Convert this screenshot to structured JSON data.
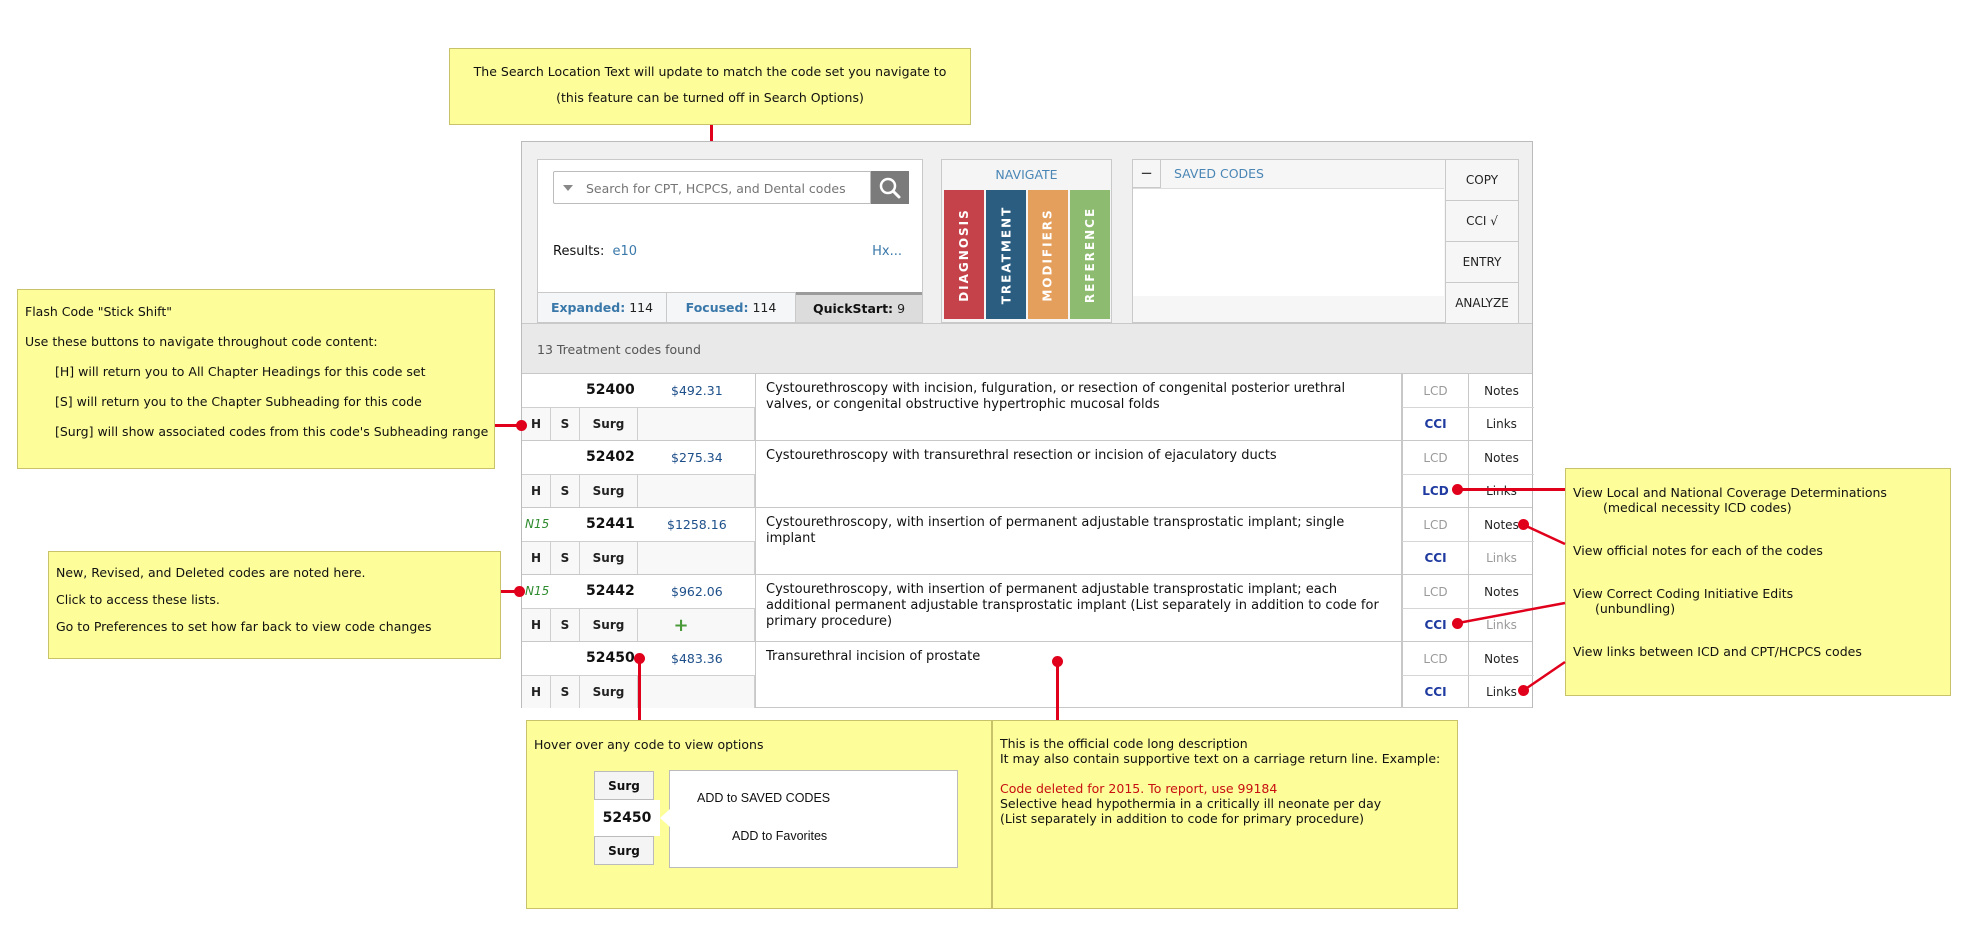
{
  "search": {
    "placeholder": "Search for CPT, HCPCS, and Dental codes",
    "results_label": "Results:",
    "results_value": "e10",
    "hx_link": "Hx..."
  },
  "tabs": [
    {
      "label": "Expanded:",
      "count": "114"
    },
    {
      "label": "Focused:",
      "count": "114"
    },
    {
      "label": "QuickStart:",
      "count": "9"
    }
  ],
  "navigate": {
    "title": "NAVIGATE",
    "tiles": [
      {
        "label": "DIAGNOSIS",
        "color": "#c6424a"
      },
      {
        "label": "TREATMENT",
        "color": "#2a5d80"
      },
      {
        "label": "MODIFIERS",
        "color": "#e59f5c"
      },
      {
        "label": "REFERENCE",
        "color": "#8dbb6f"
      }
    ]
  },
  "saved": {
    "collapse": "−",
    "title": "SAVED CODES",
    "buttons": [
      "COPY",
      "CCI √",
      "ENTRY",
      "ANALYZE"
    ]
  },
  "status_text": "13 Treatment codes found",
  "row_buttons": {
    "h": "H",
    "s": "S",
    "surg": "Surg",
    "lcd": "LCD",
    "cci": "CCI",
    "notes": "Notes",
    "links": "Links",
    "plus": "+"
  },
  "rows": [
    {
      "tag": "",
      "code": "52400",
      "price": "$492.31",
      "desc": "Cystourethroscopy with incision, fulguration, or resection of congenital posterior urethral valves, or congenital obstructive hypertrophic mucosal folds"
    },
    {
      "tag": "",
      "code": "52402",
      "price": "$275.34",
      "desc": "Cystourethroscopy with transurethral resection or incision of ejaculatory ducts"
    },
    {
      "tag": "N15",
      "code": "52441",
      "price": "$1258.16",
      "desc": "Cystourethroscopy, with insertion of permanent adjustable transprostatic implant; single implant"
    },
    {
      "tag": "N15",
      "code": "52442",
      "price": "$962.06",
      "desc": "Cystourethroscopy, with insertion of permanent adjustable transprostatic implant; each additional permanent adjustable transprostatic implant (List separately in addition to code for primary procedure)"
    },
    {
      "tag": "",
      "code": "52450",
      "price": "$483.36",
      "desc": "Transurethral incision of prostate"
    }
  ],
  "notes": {
    "top": [
      "The Search Location Text will update to match the code set you navigate to",
      "(this feature can be turned off in Search Options)"
    ],
    "flash": [
      "Flash Code \"Stick Shift\"",
      "Use these buttons to navigate throughout code content:",
      "[H] will return you to All Chapter Headings for this code set",
      "[S] will return you to the Chapter Subheading for this code",
      "[Surg] will show associated codes from this code's Subheading range"
    ],
    "newcodes": [
      "New, Revised, and Deleted codes are noted here.",
      "Click to access these lists.",
      "Go to Preferences to set how far back to view code changes"
    ],
    "right": [
      "View Local and National Coverage Determinations",
      "(medical necessity ICD codes)",
      "View official notes for each of the codes",
      "View Correct Coding Initiative Edits",
      "(unbundling)",
      "View links between ICD and CPT/HCPCS codes"
    ],
    "hover": {
      "title": "Hover over any code to view options",
      "surg": "Surg",
      "code": "52450",
      "add_saved": "ADD to SAVED CODES",
      "add_fav": "ADD to Favorites"
    },
    "desc": {
      "line1": "This is the official code long description",
      "line2": "It may also contain supportive text on a carriage return line. Example:",
      "red": "Code deleted for 2015.  To report, use 99184",
      "line3": "Selective head hypothermia in a critically ill neonate per day",
      "line4": "(List separately in addition to code for primary procedure)"
    }
  }
}
